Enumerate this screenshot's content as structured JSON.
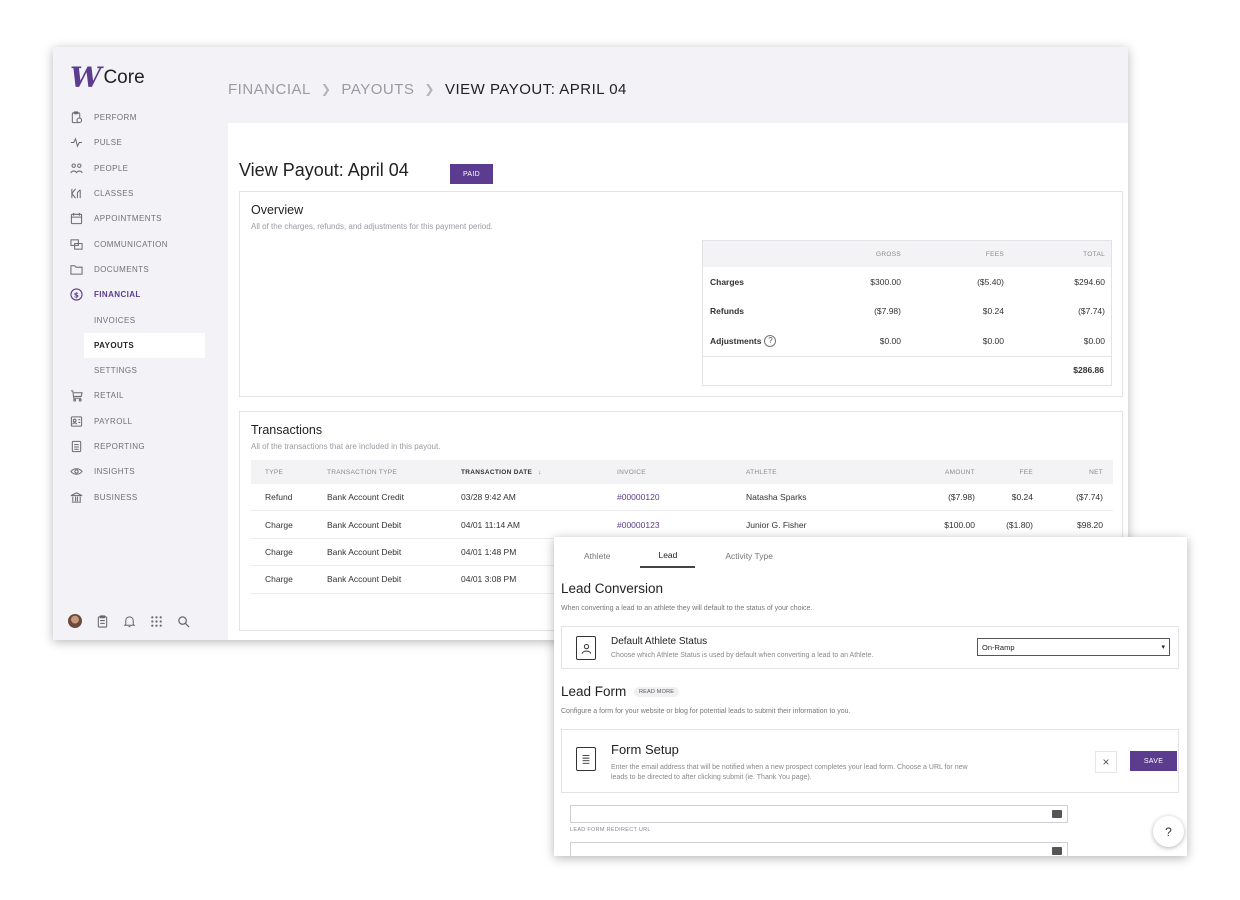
{
  "app": {
    "logo_mark": "W",
    "logo_text": "Core",
    "nav": [
      {
        "label": "PERFORM",
        "icon": "clipboard-timer-icon"
      },
      {
        "label": "PULSE",
        "icon": "pulse-icon"
      },
      {
        "label": "PEOPLE",
        "icon": "people-icon"
      },
      {
        "label": "CLASSES",
        "icon": "classes-icon"
      },
      {
        "label": "APPOINTMENTS",
        "icon": "calendar-icon"
      },
      {
        "label": "COMMUNICATION",
        "icon": "chat-icon"
      },
      {
        "label": "DOCUMENTS",
        "icon": "folder-icon"
      },
      {
        "label": "FINANCIAL",
        "icon": "dollar-circle-icon"
      }
    ],
    "financial_sub": [
      "INVOICES",
      "PAYOUTS",
      "SETTINGS"
    ],
    "nav_after": [
      {
        "label": "RETAIL",
        "icon": "cart-icon"
      },
      {
        "label": "PAYROLL",
        "icon": "payroll-icon"
      },
      {
        "label": "REPORTING",
        "icon": "report-icon"
      },
      {
        "label": "INSIGHTS",
        "icon": "eye-icon"
      },
      {
        "label": "BUSINESS",
        "icon": "bank-icon"
      }
    ],
    "breadcrumb": [
      "FINANCIAL",
      "PAYOUTS",
      "VIEW PAYOUT: APRIL 04"
    ],
    "page_title": "View Payout: April 04",
    "status_badge": "PAID",
    "overview": {
      "title": "Overview",
      "subtitle": "All of the charges, refunds, and adjustments for this payment period.",
      "headers": [
        "GROSS",
        "FEES",
        "TOTAL"
      ],
      "rows": [
        {
          "label": "Charges",
          "gross": "$300.00",
          "fees": "($5.40)",
          "total": "$294.60"
        },
        {
          "label": "Refunds",
          "gross": "($7.98)",
          "fees": "$0.24",
          "total": "($7.74)"
        },
        {
          "label": "Adjustments",
          "gross": "$0.00",
          "fees": "$0.00",
          "total": "$0.00"
        }
      ],
      "help_glyph": "?",
      "grand_total": "$286.86"
    },
    "transactions": {
      "title": "Transactions",
      "subtitle": "All of the transactions that are included in this payout.",
      "headers": [
        "TYPE",
        "TRANSACTION TYPE",
        "TRANSACTION DATE",
        "INVOICE",
        "ATHLETE",
        "AMOUNT",
        "FEE",
        "NET"
      ],
      "sort_glyph": "↓",
      "rows": [
        {
          "type": "Refund",
          "tx_type": "Bank Account Credit",
          "date": "03/28 9:42 AM",
          "invoice": "#00000120",
          "athlete": "Natasha Sparks",
          "amount": "($7.98)",
          "fee": "$0.24",
          "net": "($7.74)"
        },
        {
          "type": "Charge",
          "tx_type": "Bank Account Debit",
          "date": "04/01 11:14 AM",
          "invoice": "#00000123",
          "athlete": "Junior G. Fisher",
          "amount": "$100.00",
          "fee": "($1.80)",
          "net": "$98.20"
        },
        {
          "type": "Charge",
          "tx_type": "Bank Account Debit",
          "date": "04/01 1:48 PM",
          "invoice": "",
          "athlete": "",
          "amount": "",
          "fee": "",
          "net": ""
        },
        {
          "type": "Charge",
          "tx_type": "Bank Account Debit",
          "date": "04/01 3:08 PM",
          "invoice": "",
          "athlete": "",
          "amount": "",
          "fee": "",
          "net": ""
        }
      ]
    }
  },
  "panel": {
    "tabs": [
      "Athlete",
      "Lead",
      "Activity Type"
    ],
    "lead_conversion": {
      "title": "Lead Conversion",
      "desc": "When converting a lead to an athlete they will default to the status of your choice.",
      "box_title": "Default Athlete Status",
      "box_desc": "Choose which Athlete Status is used by default when converting a lead to an Athlete.",
      "select_value": "On-Ramp",
      "select_caret": "▾"
    },
    "lead_form": {
      "title": "Lead Form",
      "read_more": "READ MORE",
      "desc": "Configure a form for your website or blog for potential leads to submit their information to you.",
      "box_title": "Form Setup",
      "box_desc": "Enter the email address that will be notified when a new prospect completes your lead form. Choose a URL for new leads to be directed to after clicking submit (ie. Thank You page).",
      "close_glyph": "×",
      "save_label": "SAVE",
      "redirect_label": "LEAD FORM REDIRECT URL"
    },
    "help_glyph": "?"
  }
}
